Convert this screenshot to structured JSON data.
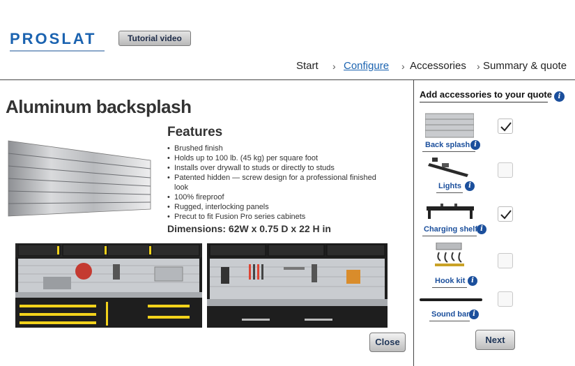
{
  "header": {
    "logo_text": "PROSLAT",
    "tutorial_button": "Tutorial video"
  },
  "steps": [
    {
      "label": "Start",
      "active": false
    },
    {
      "label": "Configure",
      "active": true
    },
    {
      "label": "Accessories",
      "active": false
    },
    {
      "label": "Summary & quote",
      "active": false
    }
  ],
  "product": {
    "title": "Aluminum backsplash",
    "features_heading": "Features",
    "features": [
      "Brushed finish",
      "Holds up to 100 lb. (45 kg) per square foot",
      "Installs over drywall to studs or directly to studs",
      "Patented hidden — screw design for a professional finished look",
      "100% fireproof",
      "Rugged, interlocking panels",
      "Precut to fit Fusion Pro series cabinets"
    ],
    "dimensions": "Dimensions: 62W x 0.75 D x 22 H in",
    "close_button": "Close"
  },
  "accessories": {
    "title": "Add accessories to your quote",
    "items": [
      {
        "label": "Back splash",
        "checked": true,
        "icon": "backsplash-icon"
      },
      {
        "label": "Lights",
        "checked": false,
        "icon": "light-icon"
      },
      {
        "label": "Charging shelf",
        "checked": true,
        "icon": "charging-shelf-icon"
      },
      {
        "label": "Hook kit",
        "checked": false,
        "icon": "hook-kit-icon"
      },
      {
        "label": "Sound bar",
        "checked": false,
        "icon": "sound-bar-icon"
      }
    ],
    "next_button": "Next"
  },
  "colors": {
    "brand_blue": "#1b63b0",
    "link_blue": "#1b4f9c",
    "cabinet_black": "#1e1e1e",
    "accent_yellow": "#f2d21b"
  }
}
